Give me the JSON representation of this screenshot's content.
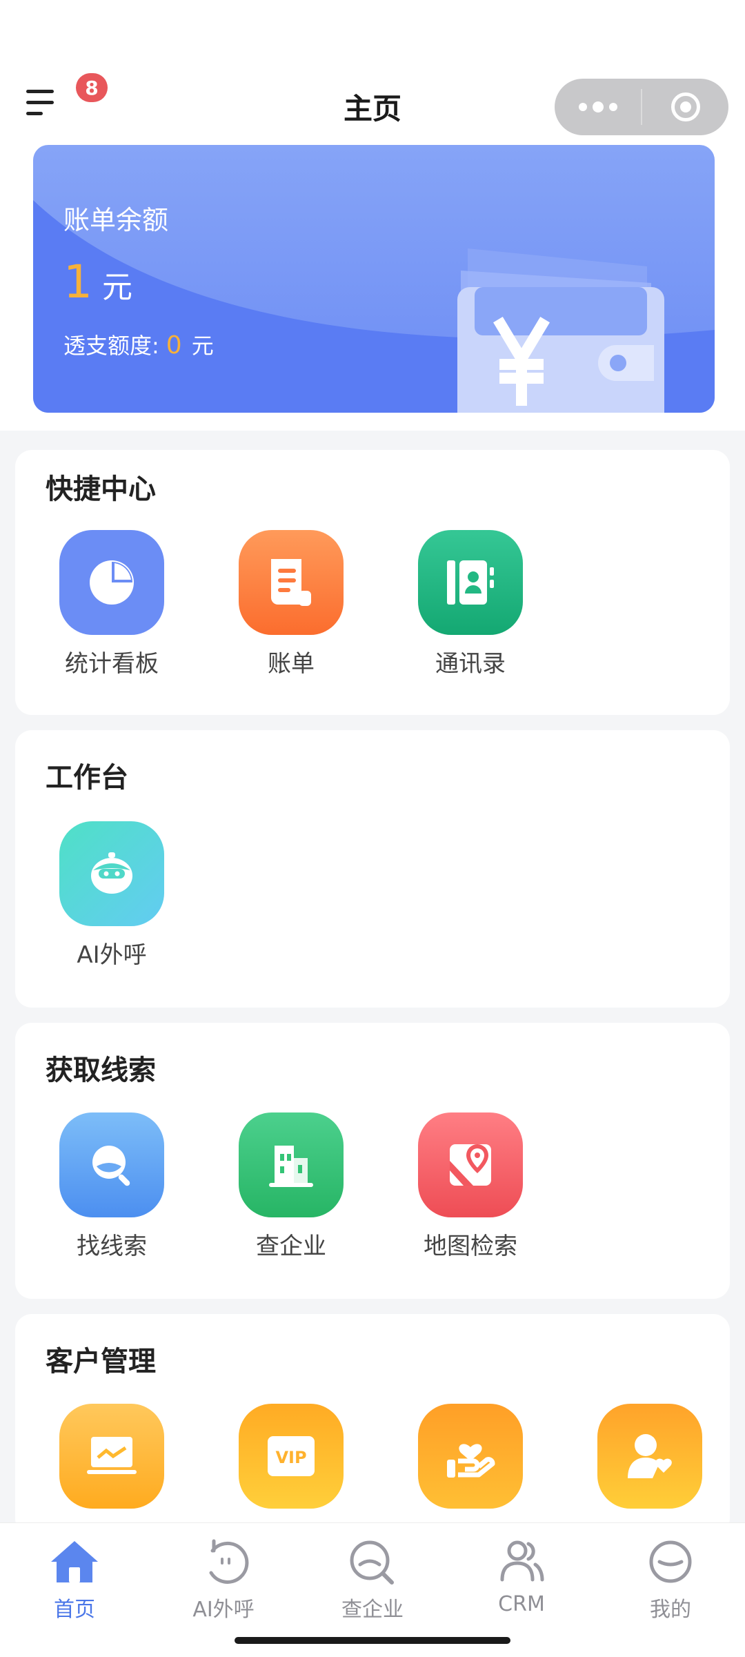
{
  "header": {
    "title": "主页",
    "badge_count": "8",
    "menu_icon": "menu-icon",
    "capsule_more_icon": "more-dots-icon",
    "capsule_close_icon": "target-icon"
  },
  "balance": {
    "label": "账单余额",
    "amount": "1",
    "unit": "元",
    "overdraft_label": "透支额度:",
    "overdraft_value": "0",
    "overdraft_unit": "元"
  },
  "sections": {
    "shortcuts": {
      "title": "快捷中心",
      "items": [
        {
          "label": "统计看板",
          "icon": "pie-chart-icon",
          "color": "#6b8df5"
        },
        {
          "label": "账单",
          "icon": "bill-icon",
          "color": "#fd7a3e"
        },
        {
          "label": "通讯录",
          "icon": "contacts-icon",
          "color": "#22b883"
        }
      ]
    },
    "workbench": {
      "title": "工作台",
      "items": [
        {
          "label": "AI外呼",
          "icon": "robot-icon",
          "color": "#4fd8c8"
        }
      ]
    },
    "leads": {
      "title": "获取线索",
      "items": [
        {
          "label": "找线索",
          "icon": "search-icon",
          "color": "#5b9df0"
        },
        {
          "label": "查企业",
          "icon": "building-icon",
          "color": "#34c476"
        },
        {
          "label": "地图检索",
          "icon": "map-pin-icon",
          "color": "#f2585f"
        }
      ]
    },
    "customers": {
      "title": "客户管理",
      "items": [
        {
          "icon": "monitor-chart-icon",
          "color": "#ffb92e"
        },
        {
          "icon": "vip-icon",
          "color": "#ffb92e"
        },
        {
          "icon": "hand-heart-icon",
          "color": "#ffa928"
        },
        {
          "icon": "user-heart-icon",
          "color": "#ffb22e"
        }
      ]
    }
  },
  "tabbar": {
    "tabs": [
      {
        "label": "首页",
        "icon": "home-icon",
        "active": true
      },
      {
        "label": "AI外呼",
        "icon": "ai-face-icon",
        "active": false
      },
      {
        "label": "查企业",
        "icon": "search-icon",
        "active": false
      },
      {
        "label": "CRM",
        "icon": "people-icon",
        "active": false
      },
      {
        "label": "我的",
        "icon": "smile-icon",
        "active": false
      }
    ],
    "active_color": "#4a76e8",
    "inactive_color": "#8f8f95"
  }
}
